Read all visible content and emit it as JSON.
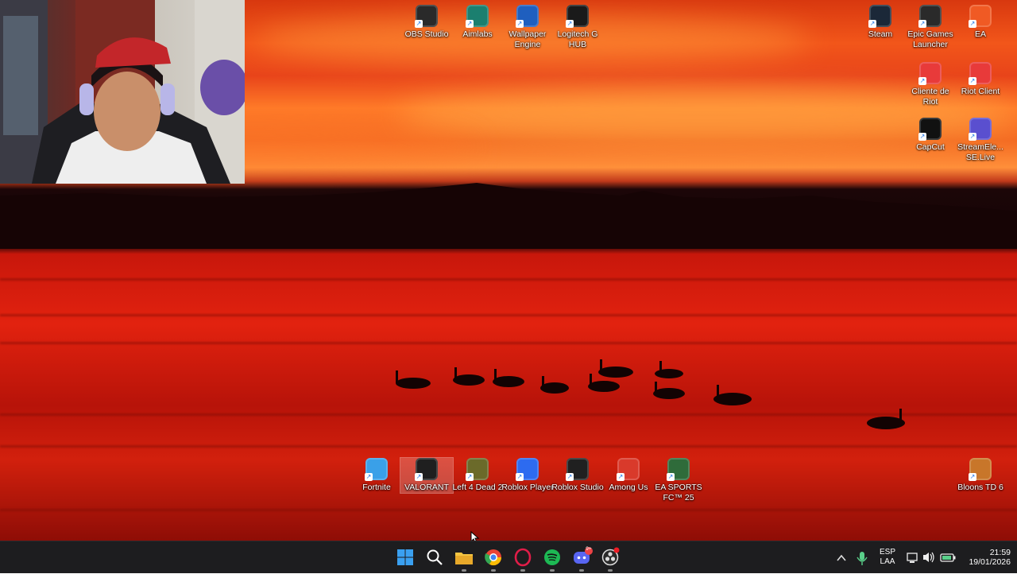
{
  "desktop": {
    "top_icons": [
      {
        "id": "obs",
        "label": "OBS Studio",
        "icon": "obs-icon",
        "color": "#2a2a2a"
      },
      {
        "id": "aimlabs",
        "label": "Aimlabs",
        "icon": "aimlabs-icon",
        "color": "#1b7f6f"
      },
      {
        "id": "wallpaper",
        "label": "Wallpaper Engine",
        "icon": "wallpaper-engine-icon",
        "color": "#1f5fbf"
      },
      {
        "id": "logitech",
        "label": "Logitech G HUB",
        "icon": "logitech-icon",
        "color": "#1a1a1a"
      }
    ],
    "right_icons": [
      {
        "id": "steam",
        "label": "Steam",
        "icon": "steam-icon",
        "color": "#1b2838"
      },
      {
        "id": "epic",
        "label": "Epic Games Launcher",
        "icon": "epic-games-icon",
        "color": "#2a2a2a"
      },
      {
        "id": "ea",
        "label": "EA",
        "icon": "ea-icon",
        "color": "#f05a24"
      },
      {
        "id": "cliente-riot",
        "label": "Cliente de Riot",
        "icon": "riot-icon",
        "color": "#e83a3a"
      },
      {
        "id": "riot-client",
        "label": "Riot Client",
        "icon": "riot-icon",
        "color": "#e83a3a"
      },
      {
        "id": "capcut",
        "label": "CapCut",
        "icon": "capcut-icon",
        "color": "#111111"
      },
      {
        "id": "streamelements",
        "label": "StreamEle... SE.Live",
        "icon": "streamelements-icon",
        "color": "#5a4fcf"
      }
    ],
    "bottom_icons": [
      {
        "id": "fortnite",
        "label": "Fortnite",
        "icon": "fortnite-icon",
        "color": "#3aa0e8"
      },
      {
        "id": "valorant",
        "label": "VALORANT",
        "icon": "valorant-icon",
        "color": "#1f1f1f"
      },
      {
        "id": "l4d2",
        "label": "Left 4 Dead 2",
        "icon": "left4dead-icon",
        "color": "#6b6a2a"
      },
      {
        "id": "roblox-player",
        "label": "Roblox Player",
        "icon": "roblox-icon",
        "color": "#2d6bf0"
      },
      {
        "id": "roblox-studio",
        "label": "Roblox Studio",
        "icon": "roblox-studio-icon",
        "color": "#202020"
      },
      {
        "id": "among-us",
        "label": "Among Us",
        "icon": "among-us-icon",
        "color": "#d93a2b"
      },
      {
        "id": "easports",
        "label": "EA SPORTS FC™ 25",
        "icon": "ea-sports-fc-icon",
        "color": "#2f6b3a"
      },
      {
        "id": "bloons",
        "label": "Bloons TD 6",
        "icon": "bloons-icon",
        "color": "#c8762a"
      }
    ],
    "selected_icon": "valorant"
  },
  "taskbar": {
    "apps": [
      {
        "id": "start",
        "icon": "windows-start-icon",
        "color": "#3aa0f0"
      },
      {
        "id": "search",
        "icon": "search-icon",
        "color": "#ffffff"
      },
      {
        "id": "explorer",
        "icon": "file-explorer-icon",
        "color": "#f4c542"
      },
      {
        "id": "chrome",
        "icon": "chrome-icon",
        "color": "#ea4335"
      },
      {
        "id": "opera",
        "icon": "opera-gx-icon",
        "color": "#e11d48"
      },
      {
        "id": "spotify",
        "icon": "spotify-icon",
        "color": "#1db954"
      },
      {
        "id": "discord",
        "icon": "discord-icon",
        "color": "#5865f2",
        "badge": "9+"
      },
      {
        "id": "obs",
        "icon": "obs-icon",
        "color": "#e0e0e0"
      }
    ],
    "tray": {
      "chevron_icon": "chevron-up-icon",
      "mic_icon": "microphone-icon",
      "lang_line1": "ESP",
      "lang_line2": "LAA",
      "network_icon": "network-icon",
      "volume_icon": "volume-icon",
      "battery_icon": "battery-icon",
      "time": "21:59",
      "date": "19/01/2026"
    }
  }
}
